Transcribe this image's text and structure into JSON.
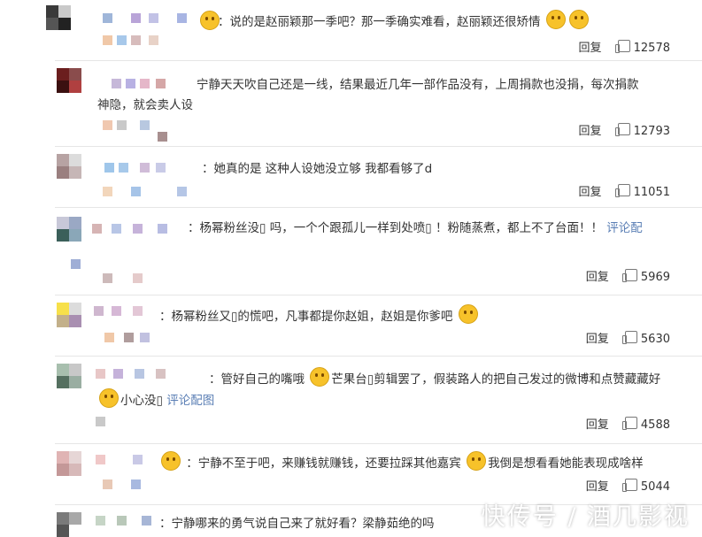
{
  "comments": [
    {
      "line1": "说的是赵丽颖那一季吧？那一季确实难看，赵丽颖还很矫情",
      "line2": "",
      "trail": "",
      "reply": "回复",
      "likes": "12578"
    },
    {
      "line1": "宁静天天吹自己还是一线，结果最近几年一部作品没有，上周捐款也没捐，每次捐款",
      "line2": "神隐，就会卖人设",
      "trail": "",
      "reply": "回复",
      "likes": "12793"
    },
    {
      "line1": "她真的是 这种人设她没立够 我都看够了d",
      "line2": "",
      "trail": "",
      "reply": "回复",
      "likes": "11051"
    },
    {
      "line1": "杨幂粉丝没▯ 吗，一个个跟孤儿一样到处喷▯ ！粉随蒸煮，都上不了台面！！",
      "line2": "",
      "trail": "评论配",
      "reply": "回复",
      "likes": "5969"
    },
    {
      "line1": "杨幂粉丝又▯的慌吧，凡事都提你赵姐，赵姐是你爹吧",
      "line2": "",
      "trail": "",
      "reply": "回复",
      "likes": "5630"
    },
    {
      "line1": "管好自己的嘴哦",
      "line1b": "芒果台▯剪辑罢了，假装路人的把自己发过的微博和点赞藏藏好",
      "line2": "小心没▯",
      "trail": "评论配图",
      "reply": "回复",
      "likes": "4588"
    },
    {
      "line1": "宁静不至于吧，来赚钱就赚钱，还要拉踩其他嘉宾",
      "line1b": "我倒是想看看她能表现成啥样",
      "line2": "",
      "trail": "",
      "reply": "回复",
      "likes": "5044"
    },
    {
      "line1": "宁静哪来的勇气说自己来了就好看？梁静茹绝的吗",
      "line2": "",
      "trail": "",
      "reply": "",
      "likes": ""
    }
  ],
  "watermark": "快传号 / 酒几影视",
  "colors": {
    "link": "#5b7fb5",
    "divider": "#e6e6e6"
  }
}
